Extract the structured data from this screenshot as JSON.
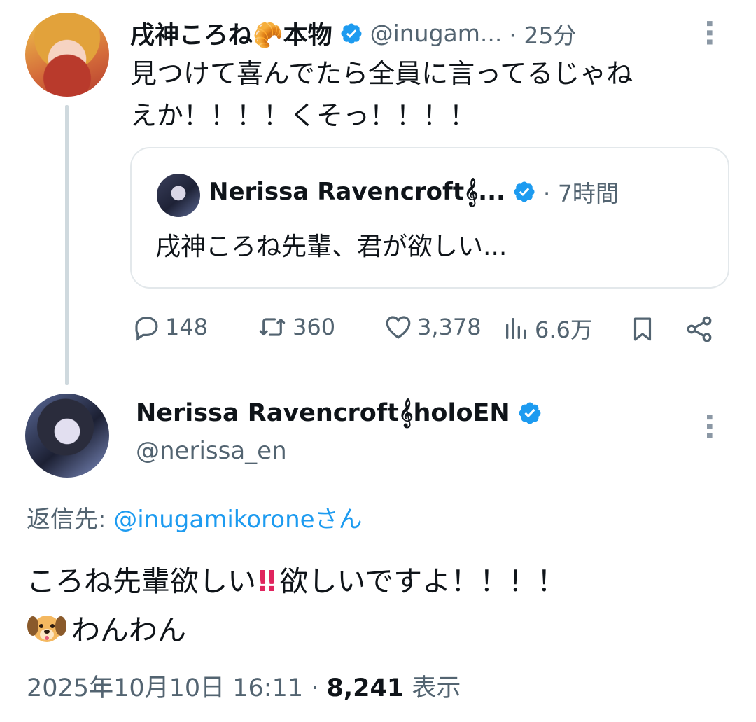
{
  "tweet1": {
    "name": "戌神ころね🥐本物",
    "handle": "@inugam...",
    "time": "· 25分",
    "text_line1": "見つけて喜んでたら全員に言ってるじゃね",
    "text_line2": "えか！！！！くそっ！！！！"
  },
  "quote": {
    "name": "Nerissa Ravencroft𝄞...",
    "time": "· 7時間",
    "text": "戌神ころね先輩、君が欲しい..."
  },
  "actions": {
    "replies": "148",
    "retweets": "360",
    "likes": "3,378",
    "views": "6.6万"
  },
  "tweet2": {
    "name": "Nerissa Ravencroft𝄞holoEN",
    "handle": "@nerissa_en",
    "reply_prefix": "返信先: ",
    "reply_to": "@inugamikoroneさん",
    "text_part1": "ころね先輩欲しい",
    "text_bang": "!!",
    "text_part2": "欲しいですよ！！！！",
    "text_line2": "わんわん",
    "date": "2025年10月10日 16:11",
    "sep": " · ",
    "views_count": "8,241",
    "views_label": " 表示"
  },
  "colors": {
    "verified": "#1d9bf0",
    "secondary_text": "#536471",
    "link": "#1d9bf0",
    "thread_line": "#cfd9de"
  },
  "icons": [
    "more-icon",
    "verified-icon",
    "reply-icon",
    "retweet-icon",
    "like-icon",
    "views-icon",
    "bookmark-icon",
    "share-icon",
    "double-exclamation-emoji",
    "dog-emoji"
  ]
}
